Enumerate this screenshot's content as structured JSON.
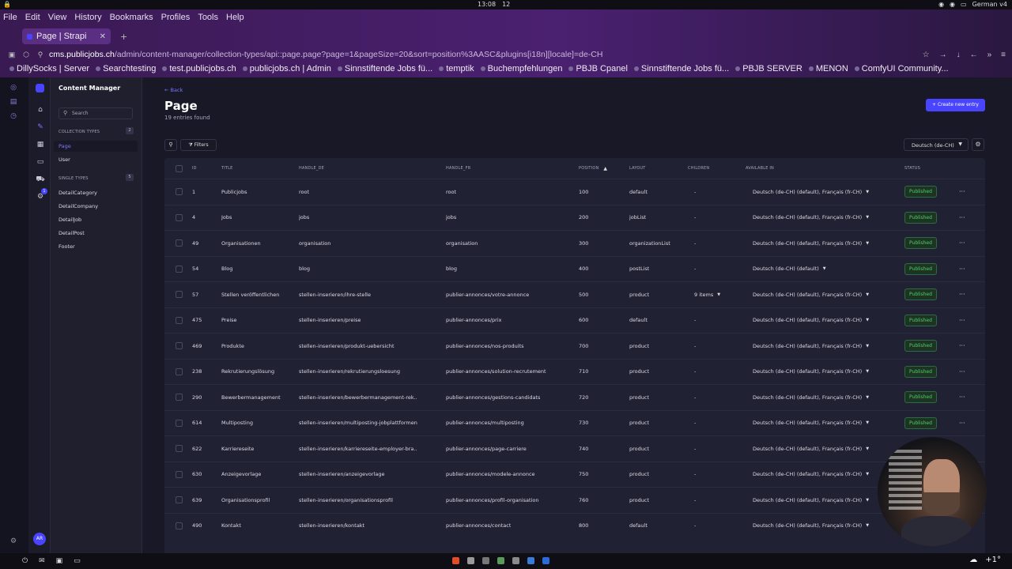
{
  "system": {
    "time": "13:08",
    "notifications": "12",
    "keyboard_layout": "German v4"
  },
  "browser": {
    "menu": [
      "File",
      "Edit",
      "View",
      "History",
      "Bookmarks",
      "Profiles",
      "Tools",
      "Help"
    ],
    "tab_title": "Page | Strapi",
    "url_host": "cms.publicjobs.ch",
    "url_path": "/admin/content-manager/collection-types/api::page.page?page=1&pageSize=20&sort=position%3AASC&plugins[i18n][locale]=de-CH",
    "bookmarks": [
      "DillySocks | Server",
      "Searchtesting",
      "test.publicjobs.ch",
      "publicjobs.ch | Admin",
      "Sinnstiftende Jobs fü...",
      "temptik",
      "Buchempfehlungen",
      "PBJB Cpanel",
      "Sinnstiftende Jobs fü...",
      "PBJB SERVER",
      "MENON",
      "ComfyUI Community..."
    ]
  },
  "sidebar": {
    "title": "Content Manager",
    "search_placeholder": "Search",
    "collection_label": "COLLECTION TYPES",
    "collection_count": "2",
    "collection_items": [
      "Page",
      "User"
    ],
    "single_label": "SINGLE TYPES",
    "single_count": "5",
    "single_items": [
      "DetailCategory",
      "DetailCompany",
      "DetailJob",
      "DetailPost",
      "Footer"
    ],
    "avatar_initials": "AR",
    "badge_count": "1"
  },
  "main": {
    "back": "Back",
    "title": "Page",
    "subtitle": "19 entries found",
    "create_button": "Create new entry",
    "filters": "Filters",
    "locale": "Deutsch (de-CH)",
    "columns": [
      "ID",
      "TITLE",
      "HANDLE_DE",
      "HANDLE_FR",
      "POSITION",
      "LAYOUT",
      "CHILDREN",
      "AVAILABLE IN",
      "STATUS"
    ],
    "rows": [
      {
        "id": "1",
        "title": "Publicjobs",
        "handle_de": "root",
        "handle_fr": "root",
        "position": "100",
        "layout": "default",
        "children": "-",
        "available": "Deutsch (de-CH) (default), Français (fr-CH)",
        "status": "Published"
      },
      {
        "id": "4",
        "title": "Jobs",
        "handle_de": "jobs",
        "handle_fr": "jobs",
        "position": "200",
        "layout": "jobList",
        "children": "-",
        "available": "Deutsch (de-CH) (default), Français (fr-CH)",
        "status": "Published"
      },
      {
        "id": "49",
        "title": "Organisationen",
        "handle_de": "organisation",
        "handle_fr": "organisation",
        "position": "300",
        "layout": "organizationList",
        "children": "-",
        "available": "Deutsch (de-CH) (default), Français (fr-CH)",
        "status": "Published"
      },
      {
        "id": "54",
        "title": "Blog",
        "handle_de": "blog",
        "handle_fr": "blog",
        "position": "400",
        "layout": "postList",
        "children": "-",
        "available": "Deutsch (de-CH) (default)",
        "status": "Published"
      },
      {
        "id": "57",
        "title": "Stellen veröffentlichen",
        "handle_de": "stellen-inserieren/ihre-stelle",
        "handle_fr": "publier-annonces/votre-annonce",
        "position": "500",
        "layout": "product",
        "children": "9 items",
        "available": "Deutsch (de-CH) (default), Français (fr-CH)",
        "status": "Published"
      },
      {
        "id": "475",
        "title": "Preise",
        "handle_de": "stellen-inserieren/preise",
        "handle_fr": "publier-annonces/prix",
        "position": "600",
        "layout": "default",
        "children": "-",
        "available": "Deutsch (de-CH) (default), Français (fr-CH)",
        "status": "Published"
      },
      {
        "id": "469",
        "title": "Produkte",
        "handle_de": "stellen-inserieren/produkt-uebersicht",
        "handle_fr": "publier-annonces/nos-produits",
        "position": "700",
        "layout": "product",
        "children": "-",
        "available": "Deutsch (de-CH) (default), Français (fr-CH)",
        "status": "Published"
      },
      {
        "id": "238",
        "title": "Rekrutierungslösung",
        "handle_de": "stellen-inserieren/rekrutierungsloesung",
        "handle_fr": "publier-annonces/solution-recrutement",
        "position": "710",
        "layout": "product",
        "children": "-",
        "available": "Deutsch (de-CH) (default), Français (fr-CH)",
        "status": "Published"
      },
      {
        "id": "290",
        "title": "Bewerbermanagement",
        "handle_de": "stellen-inserieren/bewerbermanagement-rek...",
        "handle_fr": "publier-annonces/gestions-candidats",
        "position": "720",
        "layout": "product",
        "children": "-",
        "available": "Deutsch (de-CH) (default), Français (fr-CH)",
        "status": "Published"
      },
      {
        "id": "614",
        "title": "Multiposting",
        "handle_de": "stellen-inserieren/multiposting-jobplattformen",
        "handle_fr": "publier-annonces/multiposting",
        "position": "730",
        "layout": "product",
        "children": "-",
        "available": "Deutsch (de-CH) (default), Français (fr-CH)",
        "status": "Published"
      },
      {
        "id": "622",
        "title": "Karriereseite",
        "handle_de": "stellen-inserieren/karriereseite-employer-bra...",
        "handle_fr": "publier-annonces/page-carriere",
        "position": "740",
        "layout": "product",
        "children": "-",
        "available": "Deutsch (de-CH) (default), Français (fr-CH)",
        "status": ""
      },
      {
        "id": "630",
        "title": "Anzeigevorlage",
        "handle_de": "stellen-inserieren/anzeigevorlage",
        "handle_fr": "publier-annonces/modele-annonce",
        "position": "750",
        "layout": "product",
        "children": "-",
        "available": "Deutsch (de-CH) (default), Français (fr-CH)",
        "status": ""
      },
      {
        "id": "639",
        "title": "Organisationsprofil",
        "handle_de": "stellen-inserieren/organisationsprofil",
        "handle_fr": "publier-annonces/profil-organisation",
        "position": "760",
        "layout": "product",
        "children": "-",
        "available": "Deutsch (de-CH) (default), Français (fr-CH)",
        "status": ""
      },
      {
        "id": "490",
        "title": "Kontakt",
        "handle_de": "stellen-inserieren/kontakt",
        "handle_fr": "publier-annonces/contact",
        "position": "800",
        "layout": "default",
        "children": "-",
        "available": "Deutsch (de-CH) (default), Français (fr-CH)",
        "status": ""
      }
    ]
  },
  "taskbar": {
    "right_text": "+1°"
  },
  "colors": {
    "accent": "#4945ff",
    "published": "#55cb68",
    "background": "#181826",
    "table": "#212134"
  }
}
